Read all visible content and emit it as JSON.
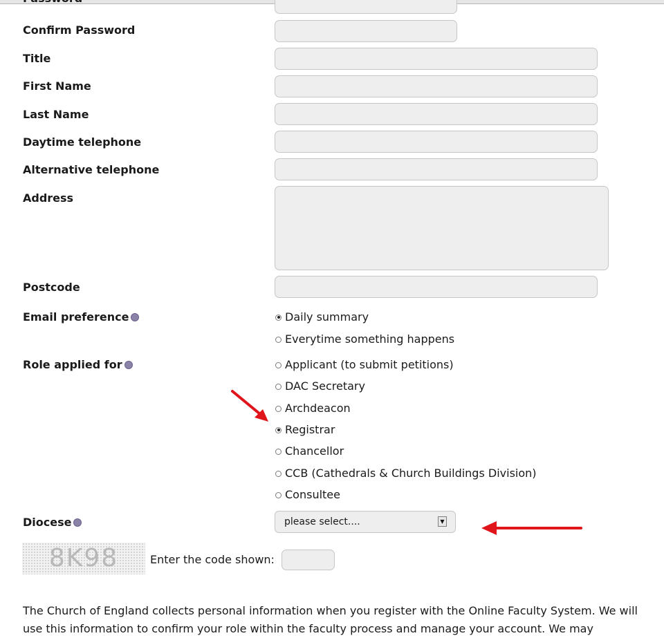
{
  "form": {
    "fields": {
      "password_label": "Password",
      "confirm_password_label": "Confirm Password",
      "title_label": "Title",
      "first_name_label": "First Name",
      "last_name_label": "Last Name",
      "daytime_tel_label": "Daytime telephone",
      "alt_tel_label": "Alternative telephone",
      "address_label": "Address",
      "postcode_label": "Postcode"
    },
    "email_preference": {
      "label": "Email preference",
      "options": [
        "Daily summary",
        "Everytime something happens"
      ],
      "selected": "Daily summary"
    },
    "role": {
      "label": "Role applied for",
      "options": [
        "Applicant (to submit petitions)",
        "DAC Secretary",
        "Archdeacon",
        "Registrar",
        "Chancellor",
        "CCB (Cathedrals & Church Buildings Division)",
        "Consultee"
      ],
      "selected": "Registrar"
    },
    "diocese": {
      "label": "Diocese",
      "selected_value": "please select...."
    },
    "captcha": {
      "image_text": "8K98",
      "prompt": "Enter the code shown:"
    }
  },
  "privacy_text": "The Church of England collects personal information when you register with the Online Faculty System. We will use this information to confirm your role within the faculty process and manage your account. We may",
  "annotation_color": "#e0141b"
}
